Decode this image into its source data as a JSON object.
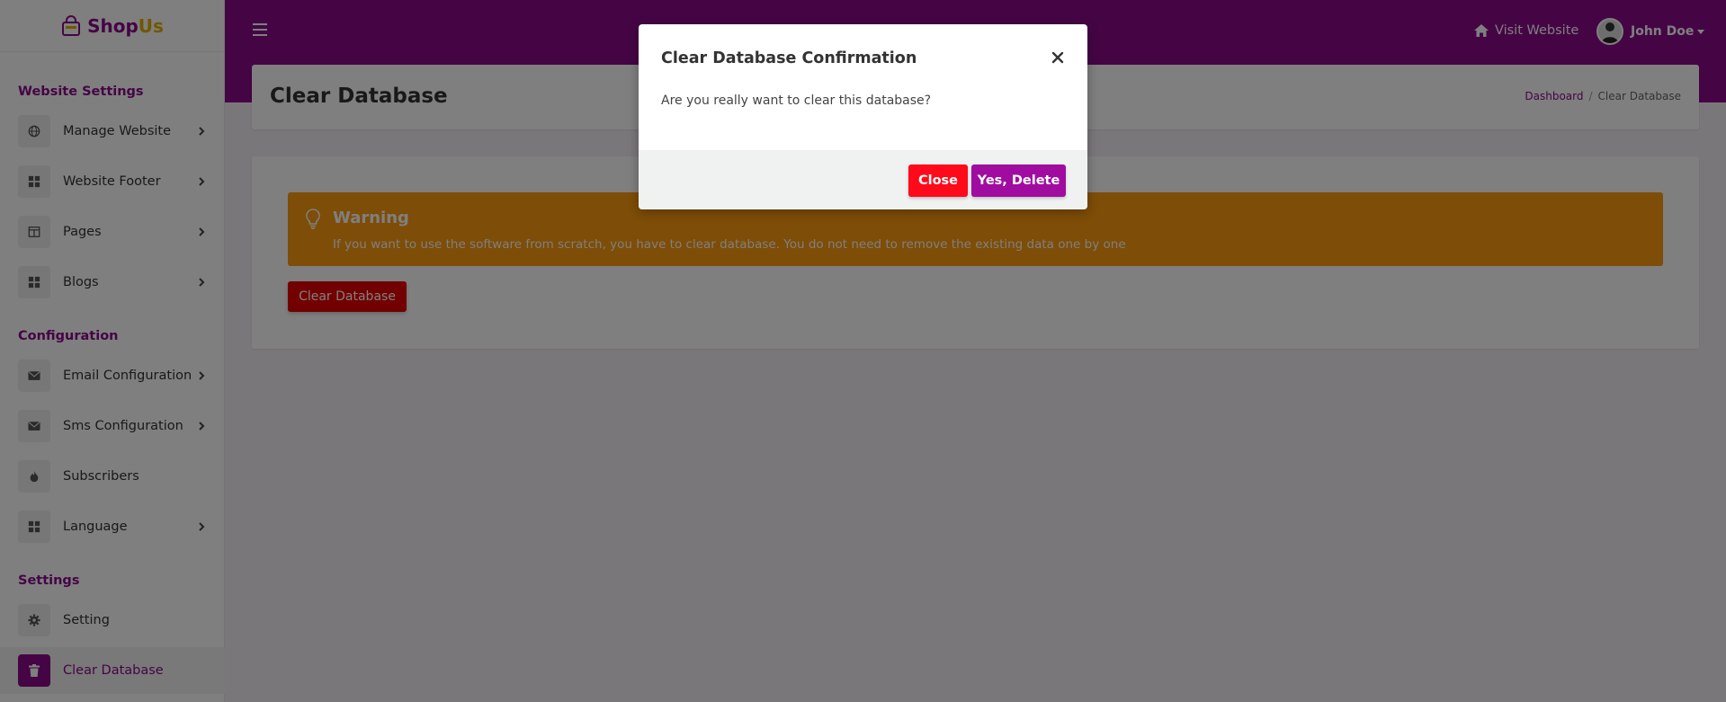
{
  "app": {
    "logo_shop": "Shop",
    "logo_us": "Us"
  },
  "sidebar": {
    "sections": [
      {
        "title": "Website Settings"
      },
      {
        "title": "Configuration"
      },
      {
        "title": "Settings"
      }
    ],
    "items": [
      {
        "label": "Manage Website",
        "icon": "globe-icon",
        "has_chevron": true
      },
      {
        "label": "Website Footer",
        "icon": "grid-icon",
        "has_chevron": true
      },
      {
        "label": "Pages",
        "icon": "columns-icon",
        "has_chevron": true
      },
      {
        "label": "Blogs",
        "icon": "grid-icon",
        "has_chevron": true
      },
      {
        "label": "Email Configuration",
        "icon": "envelope-icon",
        "has_chevron": true
      },
      {
        "label": "Sms Configuration",
        "icon": "envelope-icon",
        "has_chevron": true
      },
      {
        "label": "Subscribers",
        "icon": "fire-icon",
        "has_chevron": false
      },
      {
        "label": "Language",
        "icon": "grid-icon",
        "has_chevron": true
      },
      {
        "label": "Setting",
        "icon": "gear-icon",
        "has_chevron": false
      },
      {
        "label": "Clear Database",
        "icon": "trash-icon",
        "has_chevron": false,
        "active": true
      }
    ]
  },
  "topbar": {
    "visit_label": "Visit Website",
    "user_name": "John Doe"
  },
  "page": {
    "title": "Clear Database",
    "breadcrumb": {
      "link": "Dashboard",
      "separator": "/",
      "current": "Clear Database"
    }
  },
  "warning": {
    "title": "Warning",
    "text": "If you want to use the software from scratch, you have to clear database. You do not need to remove the existing data one by one"
  },
  "actions": {
    "clear_label": "Clear Database"
  },
  "modal": {
    "title": "Clear Database Confirmation",
    "body": "Are you really want to clear this database?",
    "close_label": "Close",
    "confirm_label": "Yes, Delete"
  },
  "colors": {
    "brand": "#8a0a8a",
    "accent_yellow": "#e0b000",
    "warning": "#fd9a0e",
    "danger": "#ff0a1a",
    "confirm": "#a00ca0"
  }
}
